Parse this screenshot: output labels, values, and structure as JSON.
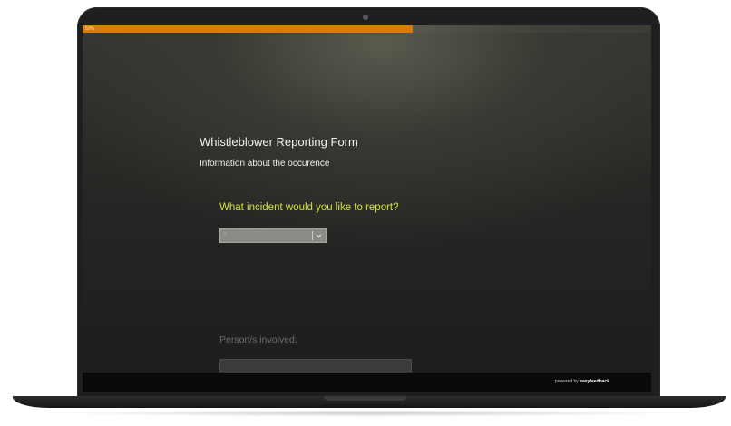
{
  "progress": {
    "percent": 0.58,
    "label": "50%"
  },
  "form": {
    "title": "Whistleblower Reporting Form",
    "subtitle": "Information about the occurence"
  },
  "question_incident": {
    "label": "What incident would you like to report?",
    "selected_value": "-"
  },
  "question_persons": {
    "label": "Person/s involved:",
    "value": ""
  },
  "footer": {
    "powered_by": "powered by",
    "brand": "easyfeedback"
  },
  "colors": {
    "progress": "#d97a0a",
    "question_accent": "#d7e13a",
    "background_dark": "#1b1c1e"
  }
}
